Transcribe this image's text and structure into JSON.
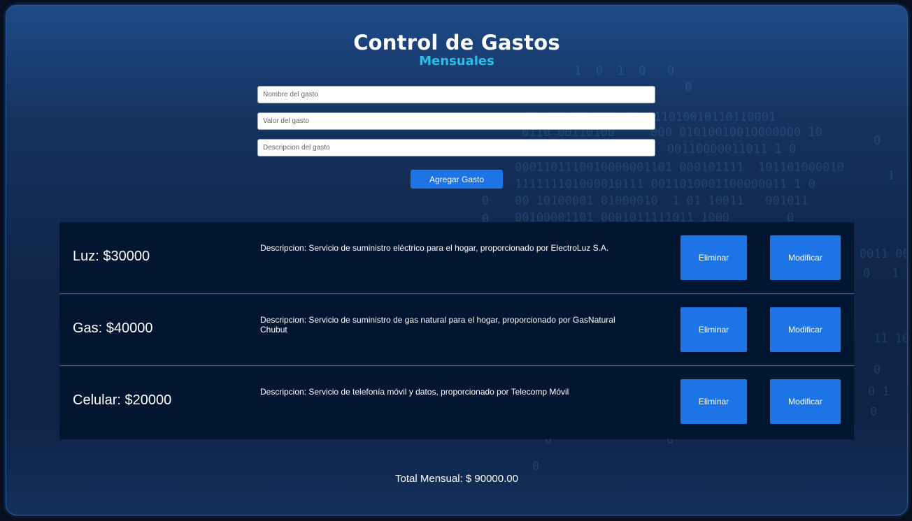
{
  "header": {
    "title": "Control de Gastos",
    "subtitle": "Mensuales"
  },
  "form": {
    "name_placeholder": "Nombre del gasto",
    "value_placeholder": "Valor del gasto",
    "description_placeholder": "Descripcion del gasto",
    "add_label": "Agregar Gasto"
  },
  "expenses": [
    {
      "title": "Luz: $30000",
      "description": "Descripcion: Servicio de suministro eléctrico para el hogar, proporcionado por ElectroLuz S.A.",
      "delete_label": "Eliminar",
      "edit_label": "Modificar"
    },
    {
      "title": "Gas: $40000",
      "description": "Descripcion: Servicio de suministro de gas natural para el hogar, proporcionado por GasNatural Chubut",
      "delete_label": "Eliminar",
      "edit_label": "Modificar"
    },
    {
      "title": "Celular: $20000",
      "description": "Descripcion: Servicio de telefonía móvil y datos, proporcionado por Telecomp Móvil",
      "delete_label": "Eliminar",
      "edit_label": "Modificar"
    }
  ],
  "total": "Total Mensual: $ 90000.00",
  "colors": {
    "accent": "#1c74e6",
    "subtitle": "#29c2f0",
    "list_background": "#021531"
  }
}
